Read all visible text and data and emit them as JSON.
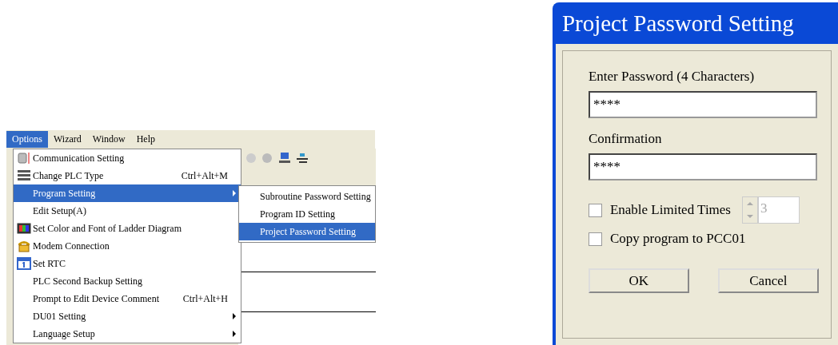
{
  "menubar": [
    {
      "label": "Options",
      "selected": true
    },
    {
      "label": "Wizard",
      "selected": false
    },
    {
      "label": "Window",
      "selected": false
    },
    {
      "label": "Help",
      "selected": false
    }
  ],
  "menu": [
    {
      "label": "Communication Setting",
      "submenu": false,
      "selected": false
    },
    {
      "label": "Change PLC Type",
      "shortcut": "Ctrl+Alt+M",
      "submenu": false,
      "selected": false
    },
    {
      "label": "Program Setting",
      "submenu": true,
      "selected": true
    },
    {
      "label": "Edit Setup(A)",
      "submenu": false,
      "selected": false
    },
    {
      "label": "Set Color and Font of Ladder Diagram",
      "submenu": false,
      "selected": false
    },
    {
      "label": "Modem Connection",
      "submenu": false,
      "selected": false
    },
    {
      "label": "Set RTC",
      "submenu": false,
      "selected": false
    },
    {
      "label": "PLC Second Backup Setting",
      "submenu": false,
      "selected": false
    },
    {
      "label": "Prompt to Edit Device Comment",
      "shortcut": "Ctrl+Alt+H",
      "submenu": false,
      "selected": false
    },
    {
      "label": "DU01 Setting",
      "submenu": true,
      "selected": false
    },
    {
      "label": "Language Setup",
      "submenu": true,
      "selected": false
    }
  ],
  "submenu": [
    {
      "label": "Subroutine Password Setting",
      "selected": false
    },
    {
      "label": "Program ID Setting",
      "selected": false
    },
    {
      "label": "Project Password Setting",
      "selected": true
    }
  ],
  "dialog": {
    "title": "Project Password Setting",
    "password_label": "Enter Password (4 Characters)",
    "password_value": "****",
    "confirm_label": "Confirmation",
    "confirm_value": "****",
    "checkboxes": [
      {
        "label": "Enable Limited Times",
        "checked": false,
        "spinner": {
          "value": "3",
          "disabled": true
        }
      },
      {
        "label": "Copy program to PCC01",
        "checked": false
      }
    ],
    "buttons": [
      "OK",
      "Cancel"
    ]
  }
}
